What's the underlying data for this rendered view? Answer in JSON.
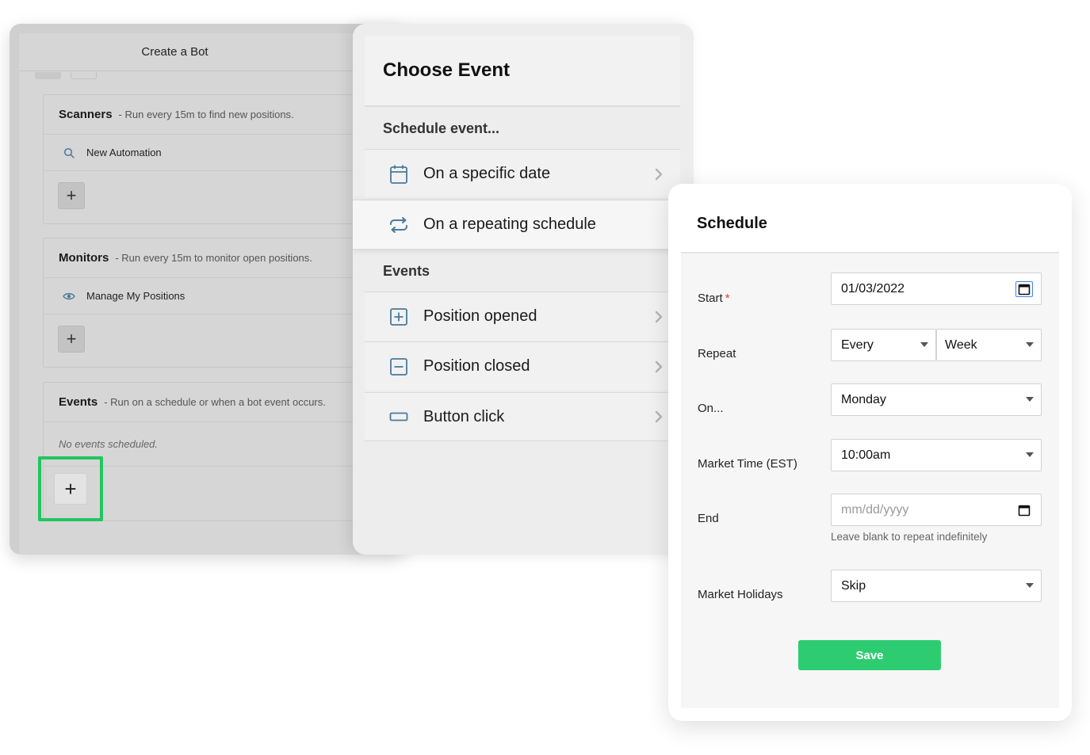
{
  "bot": {
    "title": "Create a Bot",
    "scanners": {
      "title": "Scanners",
      "subtitle": "- Run every 15m to find new positions.",
      "item": "New Automation",
      "item_icon": "search-icon"
    },
    "monitors": {
      "title": "Monitors",
      "subtitle": "- Run every 15m to monitor open positions.",
      "item": "Manage My Positions",
      "item_icon": "eye-icon"
    },
    "events": {
      "title": "Events",
      "subtitle": "- Run on a schedule or when a bot event occurs.",
      "empty": "No events scheduled."
    },
    "add_symbol": "+",
    "highlight_color": "#22c55e"
  },
  "choose_event": {
    "title": "Choose Event",
    "schedule_label": "Schedule event...",
    "schedule_items": [
      {
        "label": "On a specific date",
        "icon": "calendar-icon"
      },
      {
        "label": "On a repeating schedule",
        "icon": "repeat-icon",
        "active": true
      }
    ],
    "events_label": "Events",
    "event_items": [
      {
        "label": "Position opened",
        "icon": "plus-square-icon"
      },
      {
        "label": "Position closed",
        "icon": "minus-square-icon"
      },
      {
        "label": "Button click",
        "icon": "button-icon"
      }
    ],
    "accent": "#22c55e",
    "icon_color": "#4a7a9a"
  },
  "schedule": {
    "title": "Schedule",
    "start": {
      "label": "Start",
      "required": "*",
      "value": "01/03/2022"
    },
    "repeat": {
      "label": "Repeat",
      "every": "Every",
      "unit": "Week"
    },
    "on": {
      "label": "On...",
      "value": "Monday"
    },
    "time": {
      "label": "Market Time (EST)",
      "value": "10:00am"
    },
    "end": {
      "label": "End",
      "placeholder": "mm/dd/yyyy",
      "help": "Leave blank to repeat indefinitely"
    },
    "holidays": {
      "label": "Market Holidays",
      "value": "Skip"
    },
    "save_label": "Save",
    "save_color": "#2ecc71"
  }
}
